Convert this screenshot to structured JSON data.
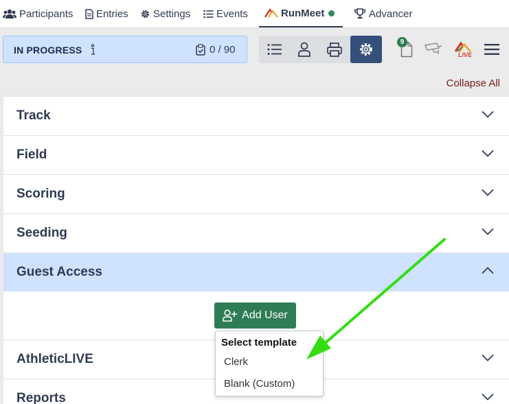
{
  "nav": {
    "participants": "Participants",
    "entries": "Entries",
    "settings": "Settings",
    "events": "Events",
    "runmeet": "RunMeet",
    "advancer": "Advancer"
  },
  "status": {
    "label": "IN PROGRESS",
    "count": "0 / 90"
  },
  "badge_count": "9",
  "live_label": "LIVE",
  "collapse_all": "Collapse All",
  "sections": {
    "track": "Track",
    "field": "Field",
    "scoring": "Scoring",
    "seeding": "Seeding",
    "guest_access": "Guest Access",
    "athleticlive": "AthleticLIVE",
    "reports": "Reports"
  },
  "add_user": "Add User",
  "template_menu": {
    "header": "Select template",
    "items": [
      "Clerk",
      "Blank (Custom)"
    ]
  },
  "colors": {
    "accent": "#34507a",
    "open_section": "#cfe2ff",
    "add_button": "#2f7d55",
    "annotation_arrow": "#33dd11"
  }
}
